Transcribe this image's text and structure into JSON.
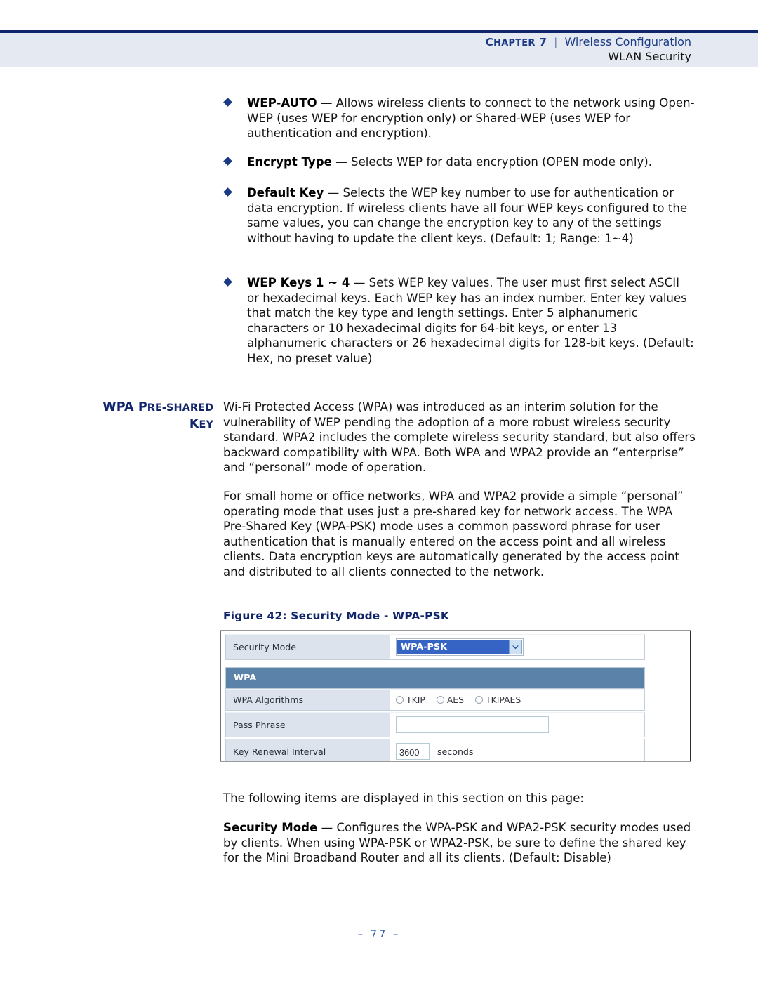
{
  "header": {
    "chapter_label": "CHAPTER 7",
    "chapter_word": "C",
    "chapter_rest": "HAPTER",
    "chapter_number": "7",
    "separator": "|",
    "section": "Wireless Configuration",
    "subsection": "WLAN Security"
  },
  "bullets": [
    {
      "term": "WEP-AUTO",
      "dash": "—",
      "text": "Allows wireless clients to connect to the network using Open-WEP (uses WEP for encryption only) or Shared-WEP (uses WEP for authentication and encryption)."
    },
    {
      "term": "Encrypt Type",
      "dash": "—",
      "text": "Selects WEP for data encryption (OPEN mode only)."
    },
    {
      "term": "Default Key",
      "dash": "—",
      "text": "Selects the WEP key number to use for authentication or data encryption. If wireless clients have all four WEP keys configured to the same values, you can change the encryption key to any of the settings without having to update the client keys. (Default: 1; Range: 1~4)"
    },
    {
      "term": "WEP Keys 1 ~ 4",
      "dash": "—",
      "text": "Sets WEP key values. The user must first select ASCII or hexadecimal keys. Each WEP key has an index number. Enter key values that match the key type and length settings. Enter 5 alphanumeric characters or 10 hexadecimal digits for 64-bit keys, or enter 13 alphanumeric characters or 26 hexadecimal digits for 128-bit keys. (Default: Hex, no preset value)"
    }
  ],
  "side_heading": {
    "line1_first": "WPA P",
    "line1_sc": "RE-S",
    "line1_cap": "HARED",
    "full": "WPA PRE-SHARED KEY",
    "line2_first": "K",
    "line2_sc": "EY"
  },
  "paragraphs": {
    "wpa_intro": "Wi-Fi Protected Access (WPA) was introduced as an interim solution for the vulnerability of WEP pending the adoption of a more robust wireless security standard. WPA2 includes the complete wireless security standard, but also offers backward compatibility with WPA. Both WPA and WPA2 provide an “enterprise” and “personal” mode of operation.",
    "wpa_personal": "For small home or office networks, WPA and WPA2 provide a simple “personal” operating mode that uses just a pre-shared key for network access. The WPA Pre-Shared Key (WPA-PSK) mode uses a common password phrase for user authentication that is manually entered on the access point and all wireless clients. Data encryption keys are automatically generated by the access point and distributed to all clients connected to the network.",
    "following_items": "The following items are displayed in this section on this page:",
    "security_mode_term": "Security Mode",
    "security_mode_dash": "—",
    "security_mode_text": "Configures the WPA-PSK and WPA2-PSK security modes used by clients. When using WPA-PSK or WPA2-PSK, be sure to define the shared key for the Mini Broadband Router and all its clients. (Default: Disable)"
  },
  "figure": {
    "caption": "Figure 42:  Security Mode - WPA-PSK",
    "security_mode_label": "Security Mode",
    "security_mode_value": "WPA-PSK",
    "section_bar": "WPA",
    "wpa_algorithms_label": "WPA Algorithms",
    "radios": [
      {
        "label": "TKIP",
        "selected": false
      },
      {
        "label": "AES",
        "selected": false
      },
      {
        "label": "TKIPAES",
        "selected": false
      }
    ],
    "pass_phrase_label": "Pass Phrase",
    "pass_phrase_value": "",
    "key_renewal_label": "Key Renewal Interval",
    "key_renewal_value": "3600",
    "key_renewal_unit": "seconds",
    "accent_select_blue": "#3664c4",
    "accent_bar_blue": "#5b82a8",
    "label_cell_bg": "#dde3ed"
  },
  "footer": {
    "page_number": "–  77  –"
  }
}
